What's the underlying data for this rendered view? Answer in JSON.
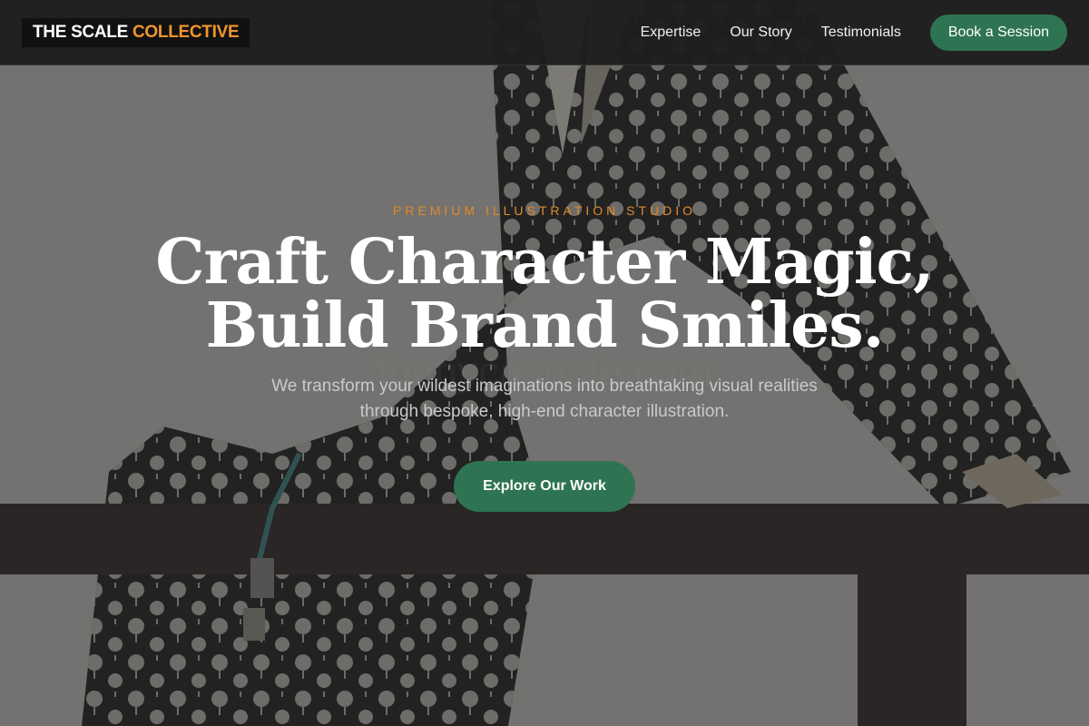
{
  "brand": {
    "name_white": "THE SCALE",
    "name_orange": "COLLECTIVE"
  },
  "nav": {
    "links": [
      "Expertise",
      "Our Story",
      "Testimonials"
    ],
    "cta": "Book a Session"
  },
  "hero": {
    "eyebrow": "PREMIUM ILLUSTRATION STUDIO",
    "headline_line1": "Craft Character Magic,",
    "headline_line2": "Build Brand Smiles.",
    "subtext": "We transform your wildest imaginations into breathtaking visual realities through bespoke, high-end character illustration.",
    "cta": "Explore Our Work",
    "background_image": "illustration of a figure in a dark polka-dot kimono sitting on a wooden fence"
  },
  "colors": {
    "accent_orange": "#f0952e",
    "button_green": "#2f7452",
    "nav_bg": "#1e1e1e"
  }
}
